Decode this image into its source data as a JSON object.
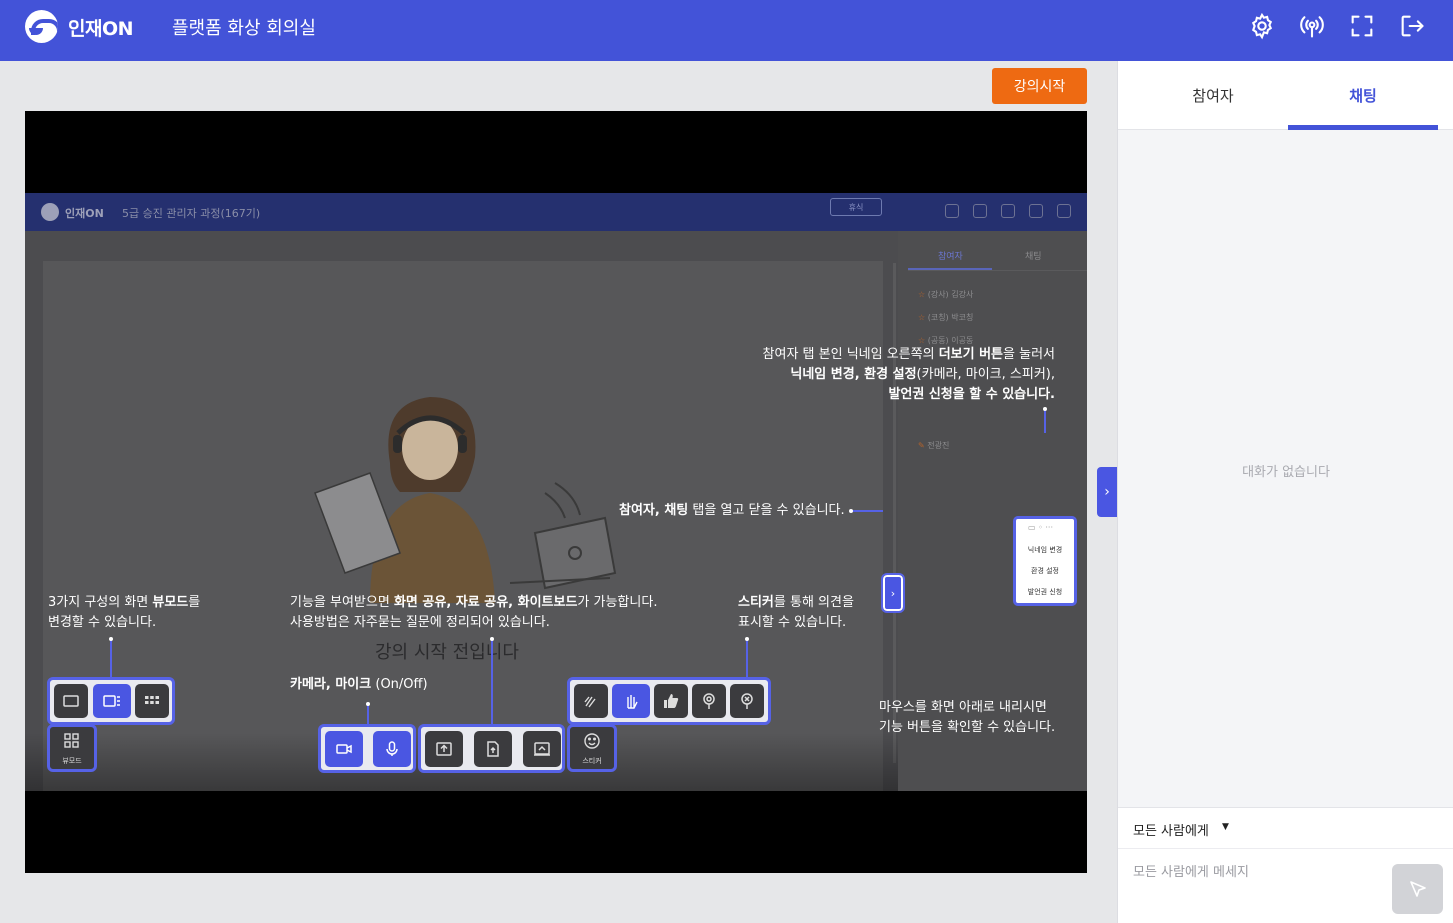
{
  "header": {
    "logo": "인재ON",
    "title": "플랫폼 화상 회의실",
    "icons": [
      "gear-icon",
      "broadcast-icon",
      "fullscreen-icon",
      "logout-icon"
    ]
  },
  "stage": {
    "start_button": "강의시작",
    "inner": {
      "logo": "인재ON",
      "title": "5급 승진 관리자 과정(167기)",
      "rest_button": "휴식",
      "tab_participants": "참여자",
      "tab_chat": "채팅",
      "rows": [
        "(강사) 김강사",
        "(코칭) 박코칭",
        "(공동) 이공동",
        "전광진"
      ],
      "status": "강의 시작 전입니다"
    },
    "notes": {
      "more_1a": "참여자 탭 본인 닉네임 오른쪽의 ",
      "more_1b": "더보기 버튼",
      "more_1c": "을 눌러서",
      "more_2a": "닉네임 변경, 환경 설정",
      "more_2b": "(카메라, 마이크, 스피커),",
      "more_3": "발언권 신청을 할 수 있습니다.",
      "toggle_a": "참여자, 채팅",
      "toggle_b": " 탭을 열고 닫을 수 있습니다.",
      "view_1a": "3가지 구성의 화면 ",
      "view_1b": "뷰모드",
      "view_1c": "를",
      "view_2": "변경할 수 있습니다.",
      "share_1a": "기능을 부여받으면 ",
      "share_1b": "화면 공유, 자료 공유, 화이트보드",
      "share_1c": "가 가능합니다.",
      "share_2": "사용방법은 자주묻는 질문에 정리되어 있습니다.",
      "cam_a": "카메라, 마이크",
      "cam_b": " (On/Off)",
      "sticker_1a": "스티커",
      "sticker_1b": "를 통해 의견을",
      "sticker_2": "표시할 수 있습니다.",
      "mouse_1": "마우스를 화면 아래로 내리시면",
      "mouse_2": "기능 버튼을 확인할 수 있습니다."
    },
    "menu": {
      "items": [
        "닉네임 변경",
        "환경 설정",
        "발언권 신청"
      ]
    },
    "labels": {
      "viewmode": "뷰모드",
      "sticker": "스티커"
    }
  },
  "sidebar": {
    "tabs": [
      "참여자",
      "채팅"
    ],
    "active_tab": "채팅",
    "empty": "대화가 없습니다",
    "recipient": "모든 사람에게",
    "placeholder": "모든 사람에게 메세지"
  },
  "colors": {
    "brand": "#4353d8",
    "accent": "#ee6a12",
    "highlight": "#5662e6"
  }
}
